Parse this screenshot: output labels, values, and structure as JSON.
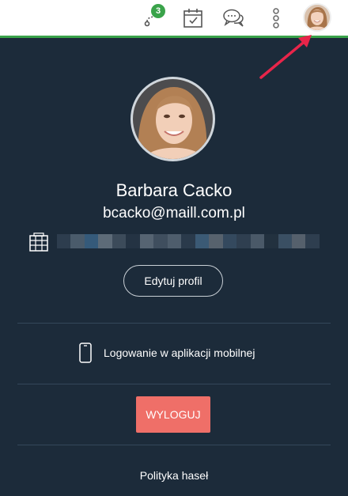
{
  "header": {
    "notifications_count": "3",
    "icons": [
      "route-icon",
      "calendar-check-icon",
      "chat-icon",
      "more-vertical-icon",
      "user-avatar"
    ]
  },
  "profile": {
    "name": "Barbara Cacko",
    "email": "bcacko@maill.com.pl",
    "edit_button": "Edytuj profil"
  },
  "menu": {
    "mobile_login": "Logowanie w aplikacji mobilnej",
    "logout": "WYLOGUJ",
    "password_policy": "Polityka haseł"
  },
  "colors": {
    "panel_bg": "#1c2b3a",
    "accent_green": "#3aa34a",
    "logout_red": "#ef6f68",
    "annotation_arrow": "#e8254a"
  }
}
